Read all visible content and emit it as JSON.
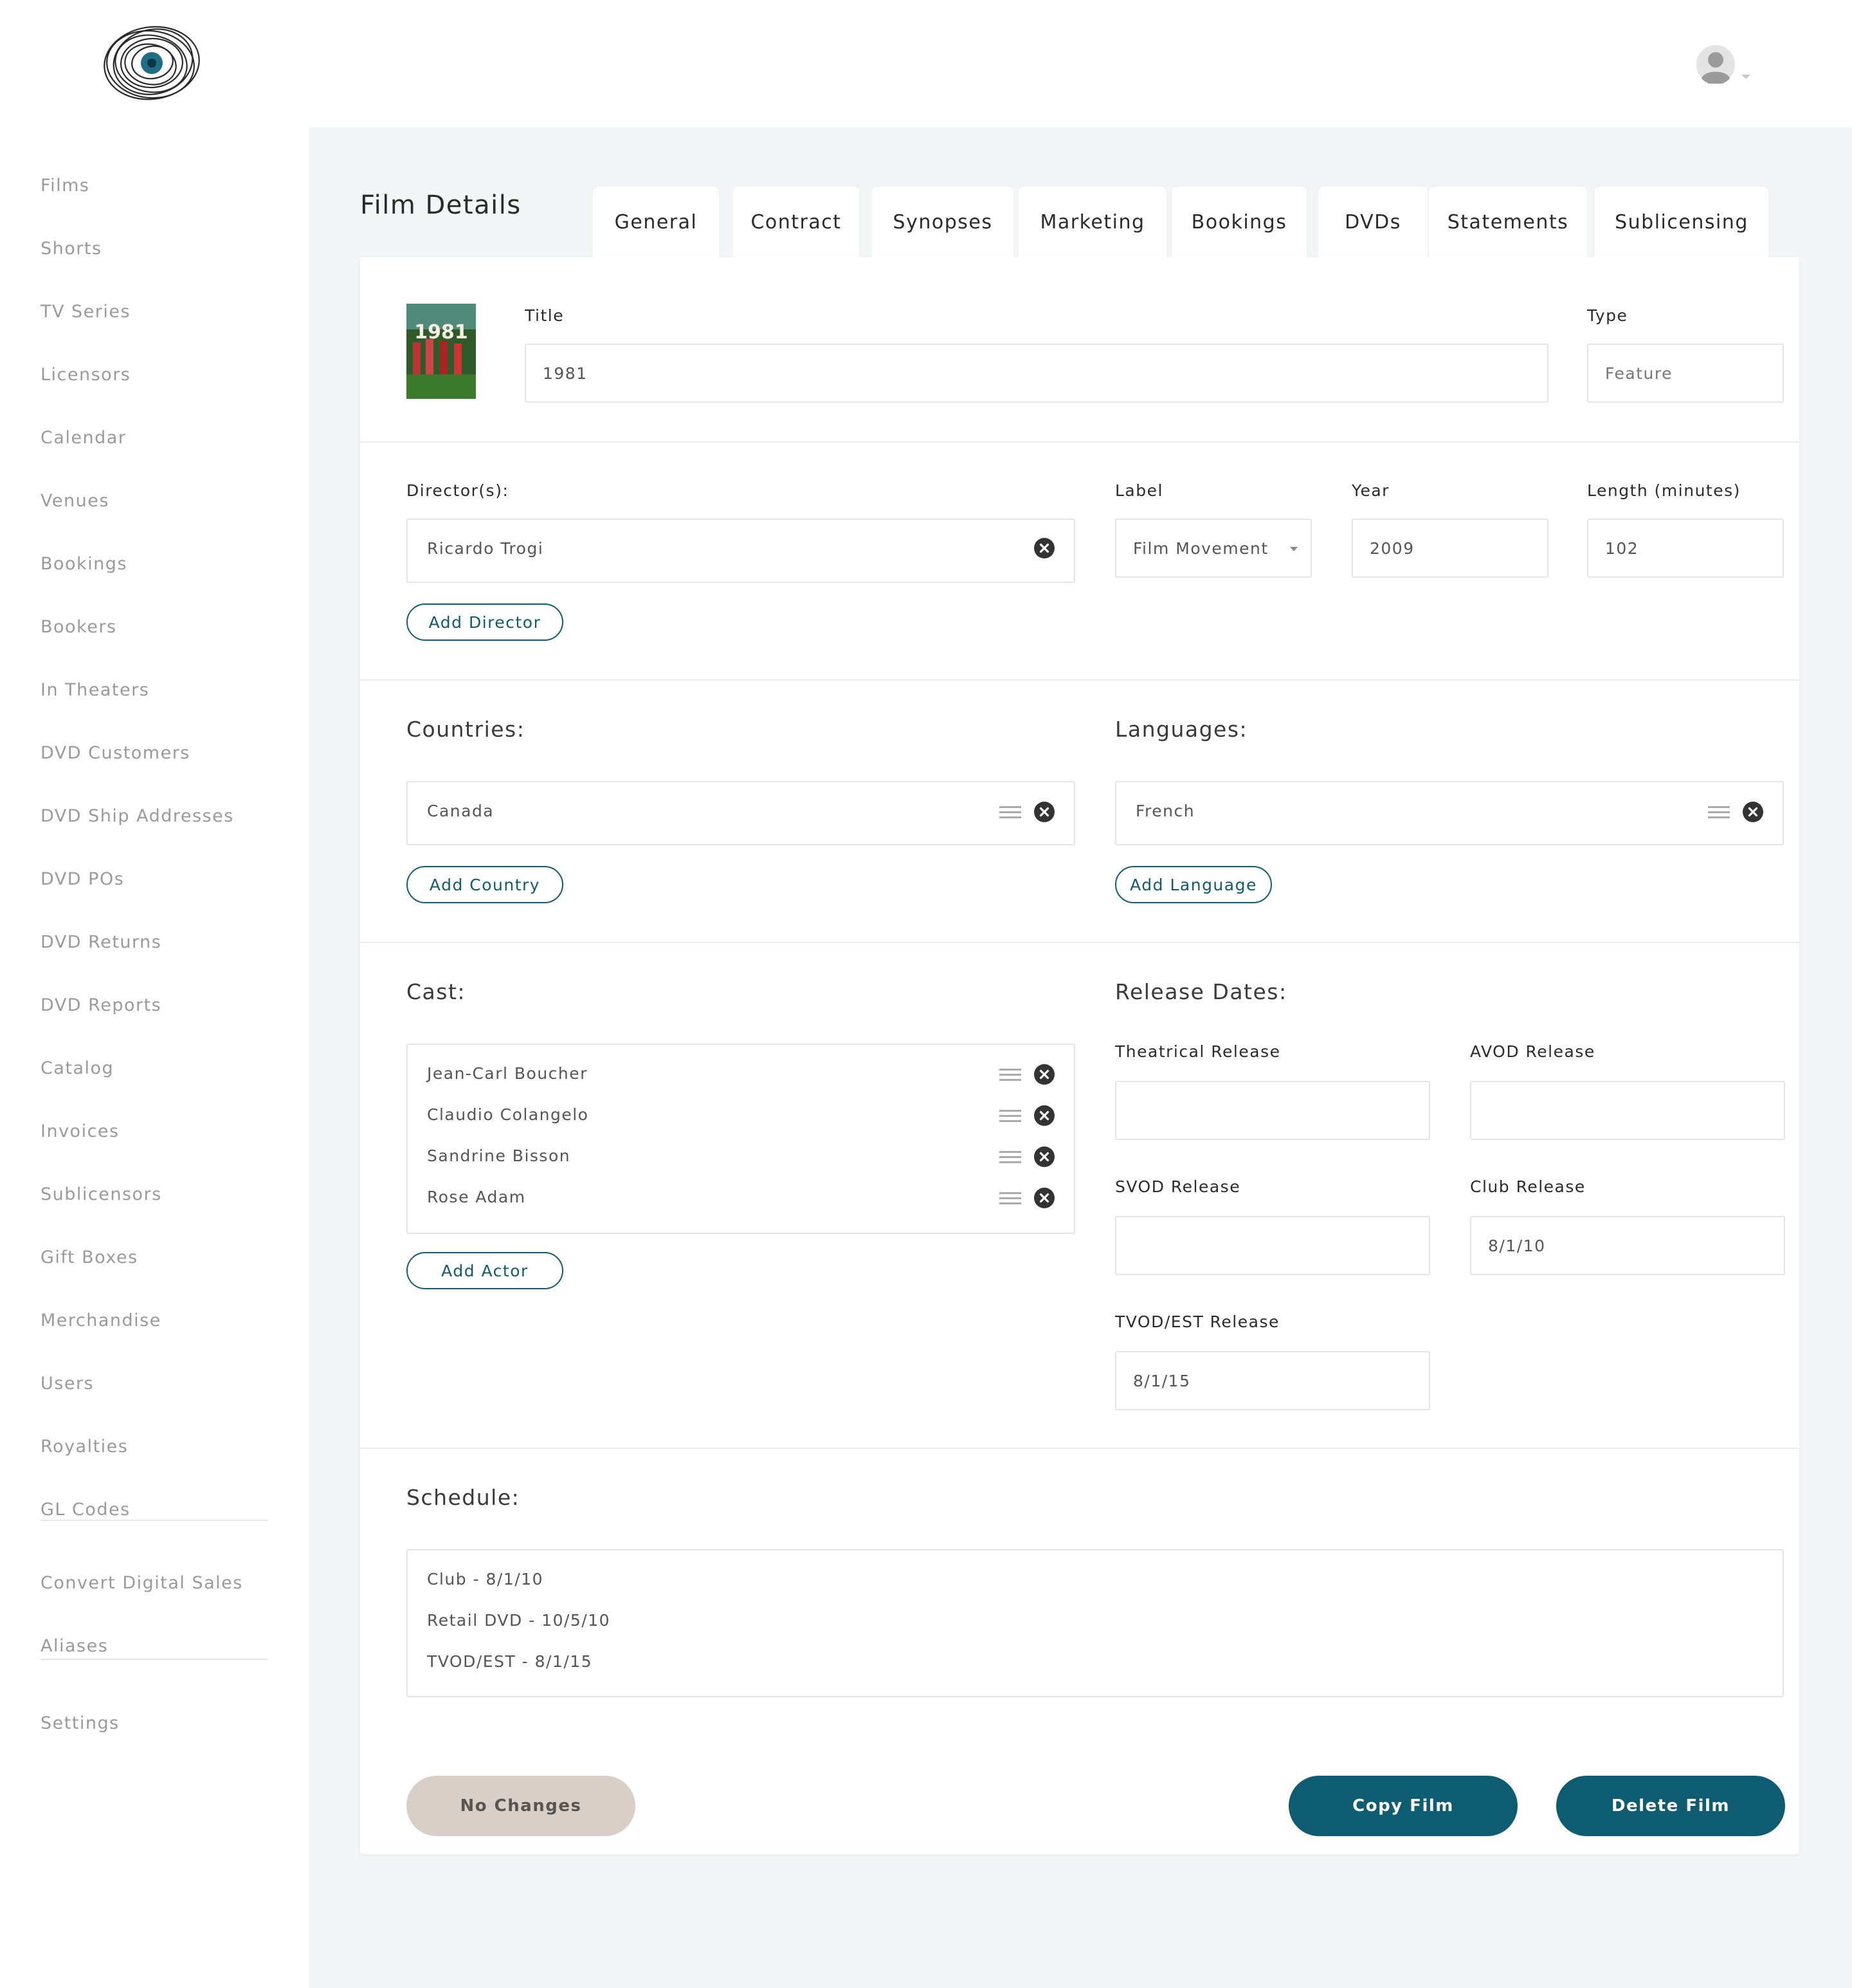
{
  "sidebar": {
    "items": [
      {
        "label": "Films"
      },
      {
        "label": "Shorts"
      },
      {
        "label": "TV Series"
      },
      {
        "label": "Licensors"
      },
      {
        "label": "Calendar"
      },
      {
        "label": "Venues"
      },
      {
        "label": "Bookings"
      },
      {
        "label": "Bookers"
      },
      {
        "label": "In Theaters"
      },
      {
        "label": "DVD Customers"
      },
      {
        "label": "DVD Ship Addresses"
      },
      {
        "label": "DVD POs"
      },
      {
        "label": "DVD Returns"
      },
      {
        "label": "DVD Reports"
      },
      {
        "label": "Catalog"
      },
      {
        "label": "Invoices"
      },
      {
        "label": "Sublicensors"
      },
      {
        "label": "Gift Boxes"
      },
      {
        "label": "Merchandise"
      },
      {
        "label": "Users"
      },
      {
        "label": "Royalties"
      },
      {
        "label": "GL Codes"
      }
    ],
    "items2": [
      {
        "label": "Convert Digital Sales"
      },
      {
        "label": "Aliases"
      }
    ],
    "items3": [
      {
        "label": "Settings"
      }
    ]
  },
  "page": {
    "title": "Film Details"
  },
  "tabs": [
    {
      "label": "General"
    },
    {
      "label": "Contract"
    },
    {
      "label": "Synopses"
    },
    {
      "label": "Marketing"
    },
    {
      "label": "Bookings"
    },
    {
      "label": "DVDs"
    },
    {
      "label": "Statements"
    },
    {
      "label": "Sublicensing"
    }
  ],
  "poster": {
    "text": "1981"
  },
  "general": {
    "title_label": "Title",
    "title_value": "1981",
    "type_label": "Type",
    "type_value": "Feature"
  },
  "details": {
    "directors_label": "Director(s):",
    "directors": [
      {
        "name": "Ricardo Trogi"
      }
    ],
    "add_director": "Add Director",
    "label_label": "Label",
    "label_value": "Film Movement",
    "year_label": "Year",
    "year_value": "2009",
    "length_label": "Length (minutes)",
    "length_value": "102"
  },
  "countries": {
    "label": "Countries:",
    "items": [
      {
        "name": "Canada"
      }
    ],
    "add": "Add Country"
  },
  "languages": {
    "label": "Languages:",
    "items": [
      {
        "name": "French"
      }
    ],
    "add": "Add Language"
  },
  "cast": {
    "label": "Cast:",
    "items": [
      {
        "name": "Jean-Carl Boucher"
      },
      {
        "name": "Claudio Colangelo"
      },
      {
        "name": "Sandrine Bisson"
      },
      {
        "name": "Rose Adam"
      }
    ],
    "add": "Add Actor"
  },
  "release": {
    "label": "Release Dates:",
    "theatrical_label": "Theatrical Release",
    "theatrical_value": "",
    "avod_label": "AVOD Release",
    "avod_value": "",
    "svod_label": "SVOD Release",
    "svod_value": "",
    "club_label": "Club Release",
    "club_value": "8/1/10",
    "tvod_label": "TVOD/EST Release",
    "tvod_value": "8/1/15"
  },
  "schedule": {
    "label": "Schedule:",
    "items": [
      {
        "text": "Club - 8/1/10"
      },
      {
        "text": "Retail DVD - 10/5/10"
      },
      {
        "text": "TVOD/EST - 8/1/15"
      }
    ]
  },
  "actions": {
    "no_changes": "No Changes",
    "copy": "Copy Film",
    "delete": "Delete Film"
  },
  "colors": {
    "accent": "#0e5c72",
    "disabled": "#d8cfc9",
    "nav_text": "#9a9a9a",
    "main_bg": "#f4f5f6"
  },
  "icons": {
    "logo": "eye-logo-icon",
    "avatar": "user-avatar-icon",
    "remove": "close-circle-icon",
    "drag": "drag-handle-icon",
    "dropdown": "chevron-down-icon"
  }
}
